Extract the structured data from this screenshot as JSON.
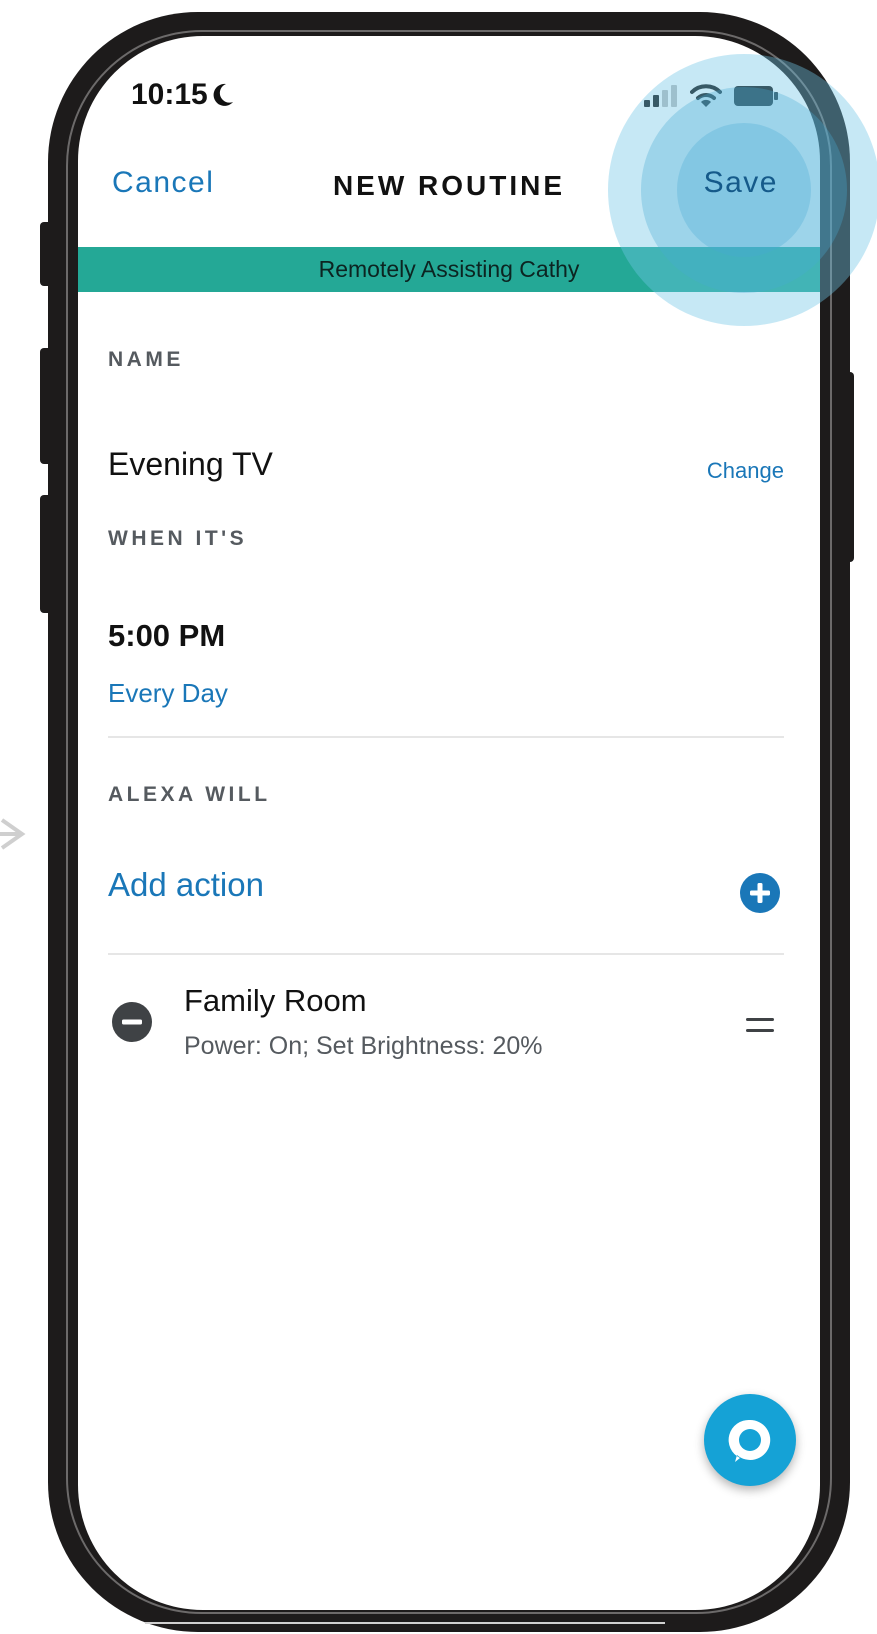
{
  "status_bar": {
    "time": "10:15"
  },
  "header": {
    "cancel_label": "Cancel",
    "title": "NEW ROUTINE",
    "save_label": "Save"
  },
  "banner": {
    "text": "Remotely Assisting Cathy"
  },
  "name_section": {
    "label": "NAME",
    "value": "Evening TV",
    "change_label": "Change"
  },
  "when_section": {
    "label": "WHEN IT'S",
    "time": "5:00 PM",
    "repeat": "Every Day"
  },
  "actions_section": {
    "label": "ALEXA WILL",
    "add_action_label": "Add action",
    "items": [
      {
        "title": "Family Room",
        "subtitle": "Power: On; Set Brightness: 20%"
      }
    ]
  },
  "colors": {
    "accent": "#1a77b8",
    "banner": "#24a896",
    "alexa_button": "#15a2d6",
    "highlight": "#70c5e6"
  },
  "icons": {
    "moon": "moon-icon",
    "signal": "cellular-signal-icon",
    "wifi": "wifi-icon",
    "battery": "battery-icon",
    "add": "add-circle-icon",
    "remove": "remove-circle-icon",
    "drag": "drag-handle-icon",
    "alexa": "alexa-icon"
  }
}
